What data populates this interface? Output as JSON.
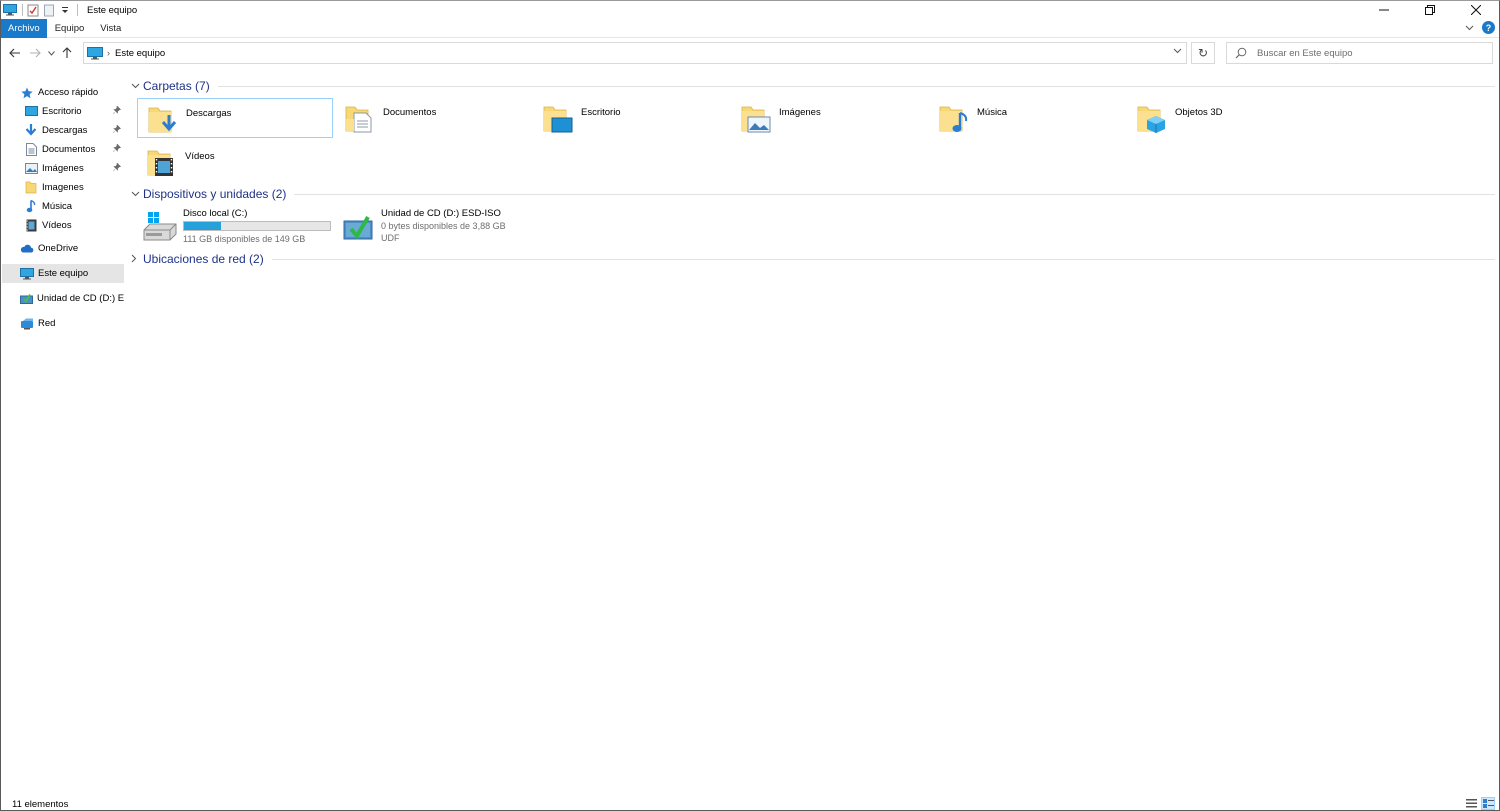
{
  "window": {
    "title": "Este equipo"
  },
  "ribbon": {
    "tabs": [
      "Archivo",
      "Equipo",
      "Vista"
    ]
  },
  "navigation": {
    "breadcrumb": "Este equipo",
    "search_placeholder": "Buscar en Este equipo"
  },
  "sidebar": {
    "quick_access": "Acceso rápido",
    "quick_items": [
      {
        "label": "Escritorio",
        "icon": "desktop-icon",
        "pinned": true
      },
      {
        "label": "Descargas",
        "icon": "download-icon",
        "pinned": true
      },
      {
        "label": "Documentos",
        "icon": "document-icon",
        "pinned": true
      },
      {
        "label": "Imágenes",
        "icon": "pictures-icon",
        "pinned": true
      },
      {
        "label": "Imagenes",
        "icon": "folder-icon",
        "pinned": false
      },
      {
        "label": "Música",
        "icon": "music-icon",
        "pinned": false
      },
      {
        "label": "Vídeos",
        "icon": "video-icon",
        "pinned": false
      }
    ],
    "onedrive": "OneDrive",
    "this_pc": "Este equipo",
    "cd_drive": "Unidad de CD (D:) ES",
    "network": "Red"
  },
  "content": {
    "folders_header": "Carpetas (7)",
    "folders": [
      {
        "label": "Descargas",
        "icon": "downloads-folder-icon"
      },
      {
        "label": "Documentos",
        "icon": "documents-folder-icon"
      },
      {
        "label": "Escritorio",
        "icon": "desktop-folder-icon"
      },
      {
        "label": "Imágenes",
        "icon": "pictures-folder-icon"
      },
      {
        "label": "Música",
        "icon": "music-folder-icon"
      },
      {
        "label": "Objetos 3D",
        "icon": "3d-objects-folder-icon"
      },
      {
        "label": "Vídeos",
        "icon": "videos-folder-icon"
      }
    ],
    "devices_header": "Dispositivos y unidades (2)",
    "drives": [
      {
        "name": "Disco local (C:)",
        "free_text": "111 GB disponibles de 149 GB",
        "used_fraction": 0.255
      },
      {
        "name": "Unidad de CD (D:) ESD-ISO",
        "free_text": "0 bytes disponibles de 3,88 GB",
        "filesystem": "UDF"
      }
    ],
    "network_header": "Ubicaciones de red (2)"
  },
  "status": {
    "item_count": "11 elementos"
  },
  "colors": {
    "accent": "#1979ca",
    "folder_yellow": "#f8d775",
    "selection": "#cce8ff",
    "group_title": "#1e3287",
    "capacity_fill": "#26a0da"
  }
}
